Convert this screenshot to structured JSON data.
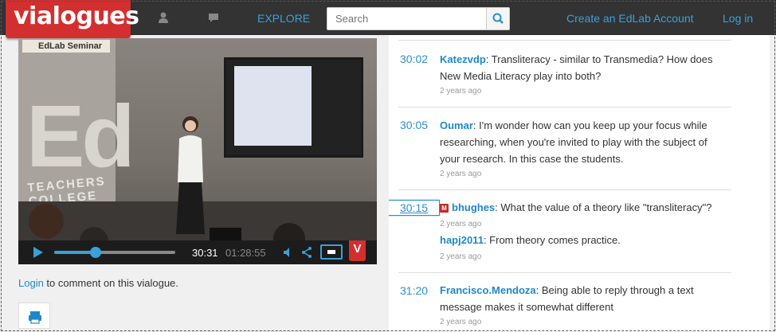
{
  "header": {
    "logo": "vialogues",
    "icons": [
      "user-icon",
      "chat-icon"
    ],
    "explore": "EXPLORE",
    "search_placeholder": "Search",
    "create_account": "Create an EdLab Account",
    "login": "Log in"
  },
  "video": {
    "tag": "EdLab Seminar",
    "banner_text": "TEACHERS COLLEGE",
    "big_letters": "Ed",
    "current_time": "30:31",
    "duration": "01:28:55",
    "progress": 0.34,
    "badge_letter": "V"
  },
  "below_video": {
    "login_link": "Login",
    "login_text": " to comment on this vialogue."
  },
  "comments": [
    {
      "time": "30:02",
      "user": "Katezvdp",
      "text": "Transliteracy - similar to Transmedia? How does New Media Literacy play into both?",
      "ago": "2 years ago"
    },
    {
      "time": "30:05",
      "user": "Oumar",
      "text": "I'm wonder how can you keep up your focus while researching, when you're invited to play with the subject of your research. In this case the students.",
      "ago": "2 years ago"
    },
    {
      "time": "30:15",
      "badge": "M",
      "user": "bhughes",
      "text": "What the value of a theory like \"transliteracy\"?",
      "ago": "2 years ago",
      "reply_user": "hapj2011",
      "reply_text": "From theory comes practice.",
      "reply_ago": "2 years ago"
    },
    {
      "time": "31:20",
      "user": "Francisco.Mendoza",
      "text": "Being able to reply through a text message makes it somewhat different",
      "ago": "2 years ago"
    }
  ]
}
